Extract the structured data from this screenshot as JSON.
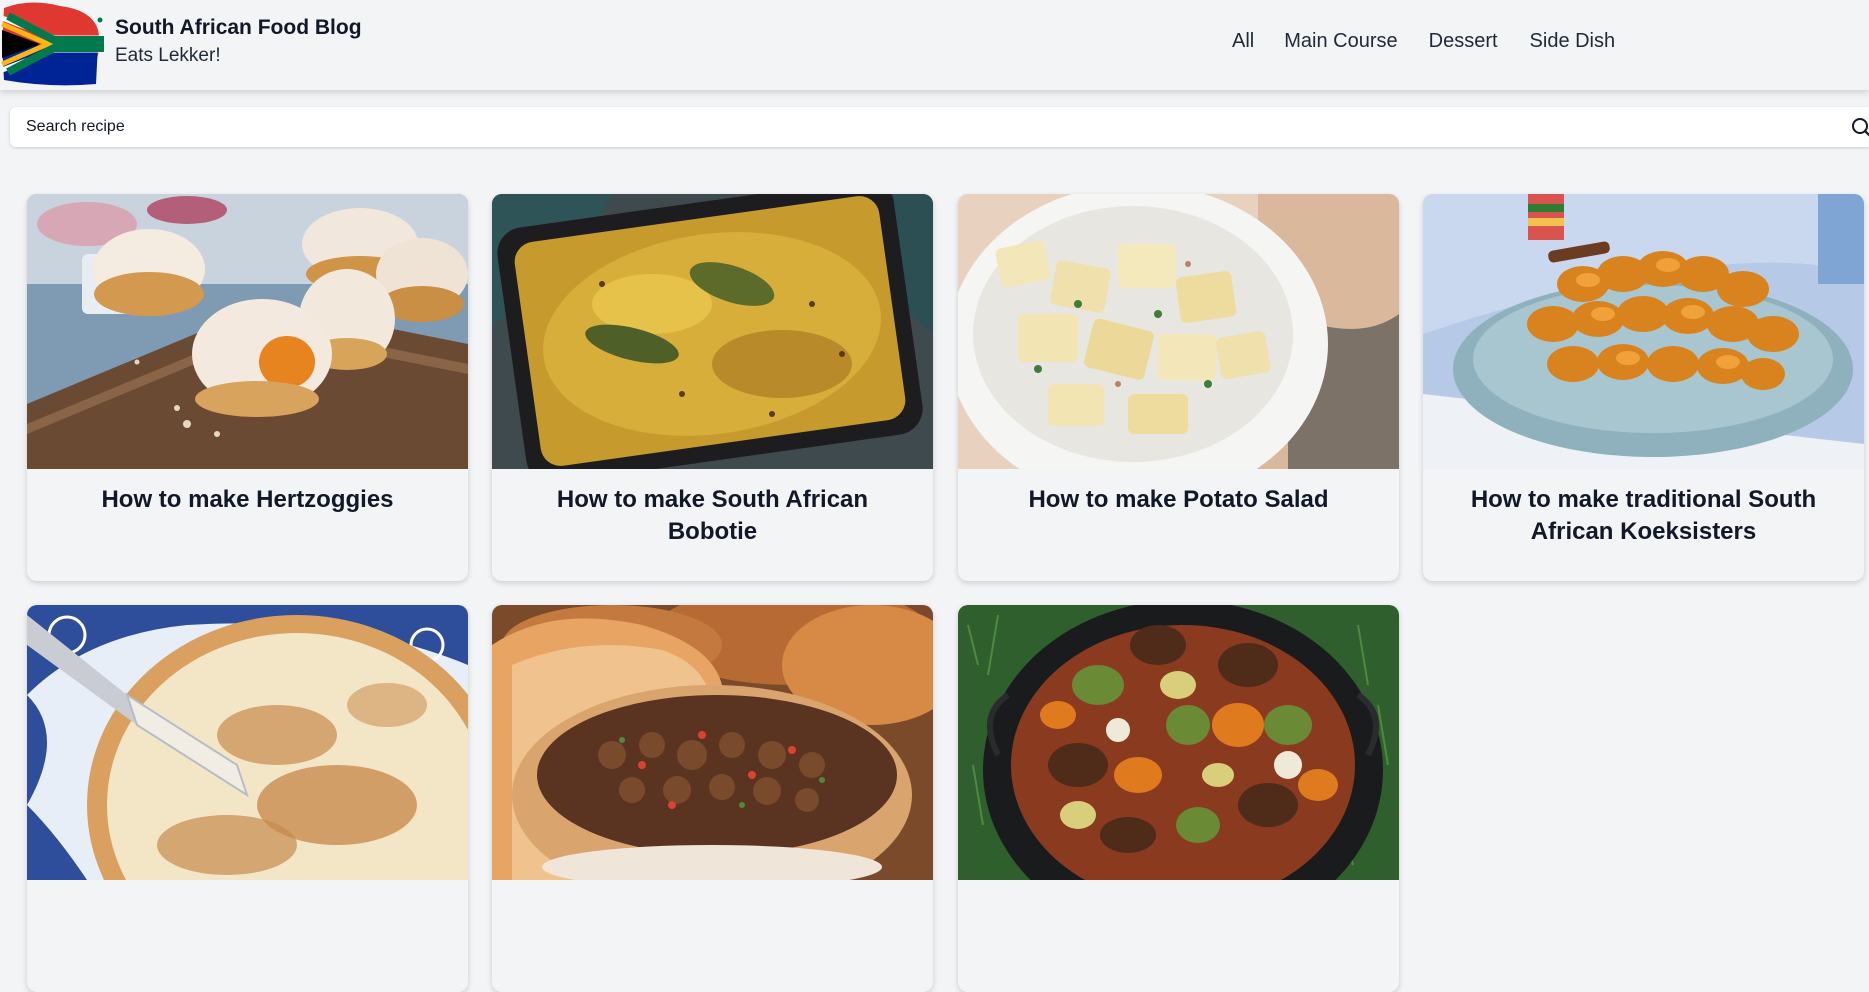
{
  "header": {
    "title": "South African Food Blog",
    "tagline": "Eats Lekker!"
  },
  "nav": {
    "all": "All",
    "main_course": "Main Course",
    "dessert": "Dessert",
    "side_dish": "Side Dish"
  },
  "search": {
    "placeholder": "Search recipe",
    "value": ""
  },
  "recipes": [
    {
      "title": "How to make Hertzoggies"
    },
    {
      "title": "How to make South African Bobotie"
    },
    {
      "title": "How to make Potato Salad"
    },
    {
      "title": "How to make traditional South African Koeksisters"
    },
    {
      "title": ""
    },
    {
      "title": ""
    },
    {
      "title": ""
    }
  ],
  "colors": {
    "background": "#f3f4f6",
    "text": "#111827",
    "card_background": "#f3f4f6"
  }
}
